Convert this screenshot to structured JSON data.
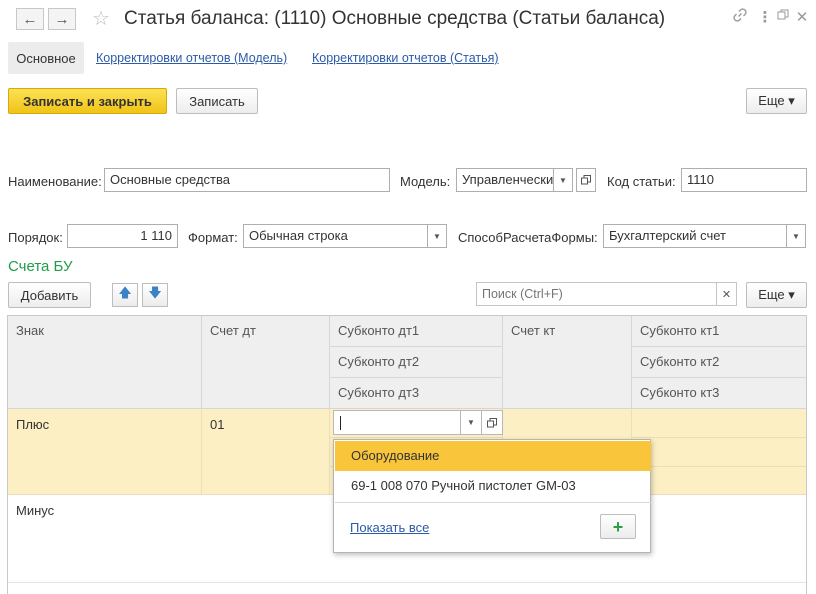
{
  "header": {
    "back_icon": "arrow-left-icon",
    "forward_icon": "arrow-right-icon",
    "favorite_icon": "star-icon",
    "title": "Статья баланса: (1110) Основные средства (Статьи баланса)",
    "link_icon": "link-icon",
    "more_icon": "more-vertical-icon",
    "window_icon": "restore-window-icon",
    "close_icon": "close-icon"
  },
  "tabs": {
    "main": "Основное",
    "model_adjustments": "Корректировки отчетов (Модель)",
    "item_adjustments": "Корректировки отчетов (Статья)"
  },
  "toolbar": {
    "save_close": "Записать и закрыть",
    "save": "Записать",
    "more": "Еще ▾"
  },
  "form": {
    "name_label": "Наименование:",
    "name_value": "Основные средства",
    "model_label": "Модель:",
    "model_value": "Управленчески",
    "code_label": "Код статьи:",
    "code_value": "1110",
    "order_label": "Порядок:",
    "order_value": "1 110",
    "format_label": "Формат:",
    "format_value": "Обычная строка",
    "method_label": "СпособРасчетаФормы:",
    "method_value": "Бухгалтерский счет"
  },
  "accounts": {
    "section_title": "Счета БУ",
    "add_label": "Добавить",
    "move_up_icon": "arrow-up-icon",
    "move_down_icon": "arrow-down-icon",
    "search_placeholder": "Поиск (Ctrl+F)",
    "clear_icon": "clear-icon",
    "more": "Еще ▾"
  },
  "table": {
    "columns": {
      "sign": "Знак",
      "debit": "Счет дт",
      "sub_debit_1": "Субконто дт1",
      "sub_debit_2": "Субконто дт2",
      "sub_debit_3": "Субконто дт3",
      "credit": "Счет кт",
      "sub_credit_1": "Субконто кт1",
      "sub_credit_2": "Субконто кт2",
      "sub_credit_3": "Субконто кт3"
    },
    "rows": [
      {
        "sign": "Плюс",
        "debit": "01"
      },
      {
        "sign": "Минус",
        "debit": ""
      }
    ]
  },
  "dropdown": {
    "options": [
      "Оборудование",
      "69-1 008 070 Ручной пистолет GM-03"
    ],
    "show_all": "Показать все",
    "add_icon": "plus-icon"
  },
  "colors": {
    "accent_yellow": "#f5cc2a",
    "row_highlight": "#fdefc4",
    "selected_option": "#f9c53b",
    "section_green": "#1e9e48",
    "link_blue": "#2b5aa8"
  }
}
